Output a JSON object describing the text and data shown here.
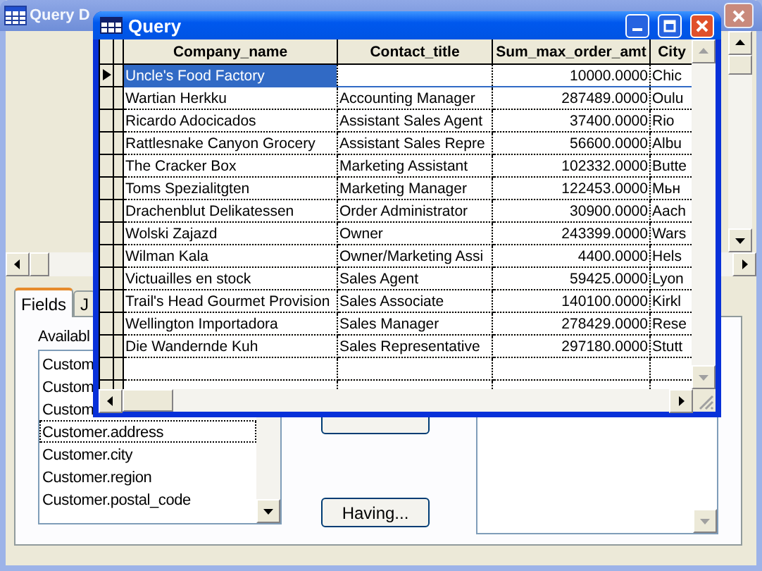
{
  "back_window": {
    "title": "Query D",
    "tabs": [
      {
        "label": "Fields",
        "selected": true
      },
      {
        "label": "J",
        "selected": false
      }
    ],
    "available_label": "Availabl",
    "available_fields": [
      {
        "label": "Custom",
        "focused": false
      },
      {
        "label": "Custom",
        "focused": false
      },
      {
        "label": "Custom",
        "focused": false
      },
      {
        "label": "Customer.address",
        "focused": true
      },
      {
        "label": "Customer.city",
        "focused": false
      },
      {
        "label": "Customer.region",
        "focused": false
      },
      {
        "label": "Customer.postal_code",
        "focused": false
      }
    ],
    "having_button": "Having..."
  },
  "query_window": {
    "title": "Query",
    "columns": [
      "Company_name",
      "Contact_title",
      "Sum_max_order_amt",
      "City"
    ],
    "rows": [
      {
        "company_name": "Uncle's Food Factory",
        "contact_title": "",
        "sum_max_order_amt": "10000.0000",
        "city": "Chic",
        "selected": true
      },
      {
        "company_name": "Wartian Herkku",
        "contact_title": "Accounting Manager",
        "sum_max_order_amt": "287489.0000",
        "city": "Oulu",
        "selected": false
      },
      {
        "company_name": "Ricardo Adocicados",
        "contact_title": "Assistant Sales Agent",
        "sum_max_order_amt": "37400.0000",
        "city": "Rio",
        "selected": false
      },
      {
        "company_name": "Rattlesnake Canyon Grocery",
        "contact_title": "Assistant Sales Repre",
        "sum_max_order_amt": "56600.0000",
        "city": "Albu",
        "selected": false
      },
      {
        "company_name": "The Cracker Box",
        "contact_title": "Marketing Assistant",
        "sum_max_order_amt": "102332.0000",
        "city": "Butte",
        "selected": false
      },
      {
        "company_name": "Toms Spezialitgten",
        "contact_title": "Marketing Manager",
        "sum_max_order_amt": "122453.0000",
        "city": "Мьн",
        "selected": false
      },
      {
        "company_name": "Drachenblut Delikatessen",
        "contact_title": "Order Administrator",
        "sum_max_order_amt": "30900.0000",
        "city": "Aach",
        "selected": false
      },
      {
        "company_name": "Wolski  Zajazd",
        "contact_title": "Owner",
        "sum_max_order_amt": "243399.0000",
        "city": "Wars",
        "selected": false
      },
      {
        "company_name": "Wilman Kala",
        "contact_title": "Owner/Marketing Assi",
        "sum_max_order_amt": "4400.0000",
        "city": "Hels",
        "selected": false
      },
      {
        "company_name": "Victuailles en stock",
        "contact_title": "Sales Agent",
        "sum_max_order_amt": "59425.0000",
        "city": "Lyon",
        "selected": false
      },
      {
        "company_name": "Trail's Head Gourmet Provision",
        "contact_title": "Sales Associate",
        "sum_max_order_amt": "140100.0000",
        "city": "Kirkl",
        "selected": false
      },
      {
        "company_name": "Wellington Importadora",
        "contact_title": "Sales Manager",
        "sum_max_order_amt": "278429.0000",
        "city": "Rese",
        "selected": false
      },
      {
        "company_name": "Die Wandernde Kuh",
        "contact_title": "Sales Representative",
        "sum_max_order_amt": "297180.0000",
        "city": "Stutt",
        "selected": false
      }
    ]
  }
}
